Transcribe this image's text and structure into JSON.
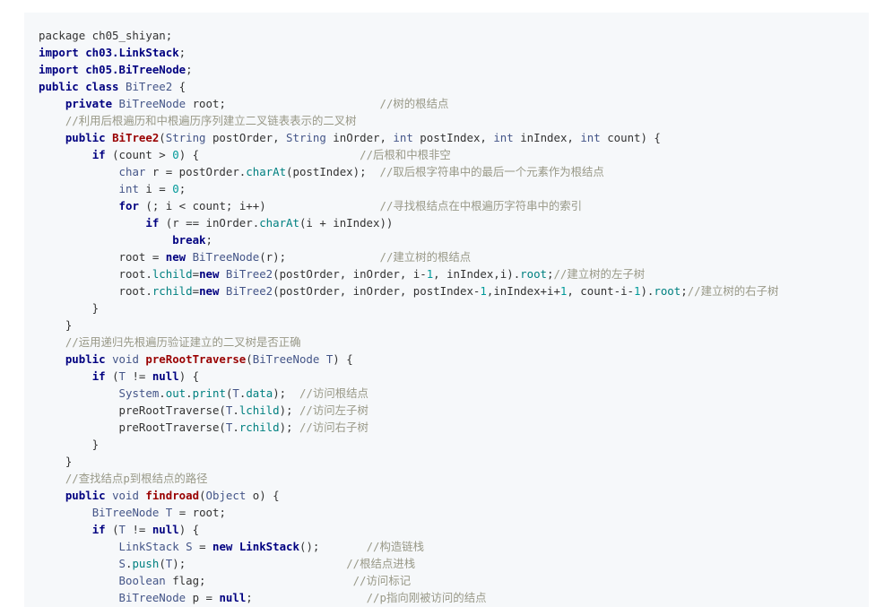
{
  "code_block": {
    "language": "java",
    "colors": {
      "background": "#f6f8fa",
      "text": "#333333",
      "keyword": "#000080",
      "type": "#445588",
      "method": "#990000",
      "comment": "#999988",
      "number": "#009999",
      "member": "#008080"
    },
    "lines": [
      [
        [
          "t",
          "package ch05_shiyan;"
        ]
      ],
      [
        [
          "k",
          "import "
        ],
        [
          "k",
          "ch03.LinkStack"
        ],
        [
          "t",
          ";"
        ]
      ],
      [
        [
          "k",
          "import "
        ],
        [
          "k",
          "ch05.BiTreeNode"
        ],
        [
          "t",
          ";"
        ]
      ],
      [
        [
          "k",
          "public class "
        ],
        [
          "y",
          "BiTree2"
        ],
        [
          "t",
          " {"
        ]
      ],
      [
        [
          "t",
          "    "
        ],
        [
          "k",
          "private "
        ],
        [
          "y",
          "BiTreeNode"
        ],
        [
          "t",
          " root;                       "
        ],
        [
          "c",
          "//树的根结点"
        ]
      ],
      [
        [
          "t",
          "    "
        ],
        [
          "c",
          "//利用后根遍历和中根遍历序列建立二叉链表表示的二叉树"
        ]
      ],
      [
        [
          "t",
          "    "
        ],
        [
          "k",
          "public "
        ],
        [
          "f",
          "BiTree2"
        ],
        [
          "t",
          "("
        ],
        [
          "y",
          "String"
        ],
        [
          "t",
          " postOrder, "
        ],
        [
          "y",
          "String"
        ],
        [
          "t",
          " inOrder, "
        ],
        [
          "y",
          "int"
        ],
        [
          "t",
          " postIndex, "
        ],
        [
          "y",
          "int"
        ],
        [
          "t",
          " inIndex, "
        ],
        [
          "y",
          "int"
        ],
        [
          "t",
          " count) {"
        ]
      ],
      [
        [
          "t",
          "        "
        ],
        [
          "k",
          "if"
        ],
        [
          "t",
          " (count > "
        ],
        [
          "n",
          "0"
        ],
        [
          "t",
          ") {                        "
        ],
        [
          "c",
          "//后根和中根非空"
        ]
      ],
      [
        [
          "t",
          "            "
        ],
        [
          "y",
          "char"
        ],
        [
          "t",
          " r = postOrder."
        ],
        [
          "m",
          "charAt"
        ],
        [
          "t",
          "(postIndex);  "
        ],
        [
          "c",
          "//取后根字符串中的最后一个元素作为根结点"
        ]
      ],
      [
        [
          "t",
          "            "
        ],
        [
          "y",
          "int"
        ],
        [
          "t",
          " i = "
        ],
        [
          "n",
          "0"
        ],
        [
          "t",
          ";"
        ]
      ],
      [
        [
          "t",
          "            "
        ],
        [
          "k",
          "for"
        ],
        [
          "t",
          " (; i < count; i++)                 "
        ],
        [
          "c",
          "//寻找根结点在中根遍历字符串中的索引"
        ]
      ],
      [
        [
          "t",
          "                "
        ],
        [
          "k",
          "if"
        ],
        [
          "t",
          " (r == inOrder."
        ],
        [
          "m",
          "charAt"
        ],
        [
          "t",
          "(i + inIndex))"
        ]
      ],
      [
        [
          "t",
          "                    "
        ],
        [
          "k",
          "break"
        ],
        [
          "t",
          ";"
        ]
      ],
      [
        [
          "t",
          "            root = "
        ],
        [
          "k",
          "new "
        ],
        [
          "y",
          "BiTreeNode"
        ],
        [
          "t",
          "(r);              "
        ],
        [
          "c",
          "//建立树的根结点"
        ]
      ],
      [
        [
          "t",
          "            root."
        ],
        [
          "m",
          "lchild"
        ],
        [
          "t",
          "="
        ],
        [
          "k",
          "new "
        ],
        [
          "y",
          "BiTree2"
        ],
        [
          "t",
          "(postOrder, inOrder, i-"
        ],
        [
          "n",
          "1"
        ],
        [
          "t",
          ", inIndex,i)."
        ],
        [
          "m",
          "root"
        ],
        [
          "t",
          ";"
        ],
        [
          "c",
          "//建立树的左子树"
        ]
      ],
      [
        [
          "t",
          "            root."
        ],
        [
          "m",
          "rchild"
        ],
        [
          "t",
          "="
        ],
        [
          "k",
          "new "
        ],
        [
          "y",
          "BiTree2"
        ],
        [
          "t",
          "(postOrder, inOrder, postIndex-"
        ],
        [
          "n",
          "1"
        ],
        [
          "t",
          ",inIndex+i+"
        ],
        [
          "n",
          "1"
        ],
        [
          "t",
          ", count-i-"
        ],
        [
          "n",
          "1"
        ],
        [
          "t",
          ")."
        ],
        [
          "m",
          "root"
        ],
        [
          "t",
          ";"
        ],
        [
          "c",
          "//建立树的右子树"
        ]
      ],
      [
        [
          "t",
          "        }"
        ]
      ],
      [
        [
          "t",
          "    }"
        ]
      ],
      [
        [
          "t",
          "    "
        ],
        [
          "c",
          "//运用递归先根遍历验证建立的二叉树是否正确"
        ]
      ],
      [
        [
          "t",
          "    "
        ],
        [
          "k",
          "public "
        ],
        [
          "y",
          "void"
        ],
        [
          "t",
          " "
        ],
        [
          "f",
          "preRootTraverse"
        ],
        [
          "t",
          "("
        ],
        [
          "y",
          "BiTreeNode"
        ],
        [
          "t",
          " "
        ],
        [
          "y",
          "T"
        ],
        [
          "t",
          ") {"
        ]
      ],
      [
        [
          "t",
          "        "
        ],
        [
          "k",
          "if"
        ],
        [
          "t",
          " ("
        ],
        [
          "y",
          "T"
        ],
        [
          "t",
          " != "
        ],
        [
          "k",
          "null"
        ],
        [
          "t",
          ") {"
        ]
      ],
      [
        [
          "t",
          "            "
        ],
        [
          "y",
          "System"
        ],
        [
          "t",
          "."
        ],
        [
          "m",
          "out"
        ],
        [
          "t",
          "."
        ],
        [
          "m",
          "print"
        ],
        [
          "t",
          "("
        ],
        [
          "y",
          "T"
        ],
        [
          "t",
          "."
        ],
        [
          "m",
          "data"
        ],
        [
          "t",
          ");  "
        ],
        [
          "c",
          "//访问根结点"
        ]
      ],
      [
        [
          "t",
          "            preRootTraverse("
        ],
        [
          "y",
          "T"
        ],
        [
          "t",
          "."
        ],
        [
          "m",
          "lchild"
        ],
        [
          "t",
          "); "
        ],
        [
          "c",
          "//访问左子树"
        ]
      ],
      [
        [
          "t",
          "            preRootTraverse("
        ],
        [
          "y",
          "T"
        ],
        [
          "t",
          "."
        ],
        [
          "m",
          "rchild"
        ],
        [
          "t",
          "); "
        ],
        [
          "c",
          "//访问右子树"
        ]
      ],
      [
        [
          "t",
          "        }"
        ]
      ],
      [
        [
          "t",
          "    }"
        ]
      ],
      [
        [
          "t",
          "    "
        ],
        [
          "c",
          "//查找结点p到根结点的路径"
        ]
      ],
      [
        [
          "t",
          "    "
        ],
        [
          "k",
          "public "
        ],
        [
          "y",
          "void"
        ],
        [
          "t",
          " "
        ],
        [
          "f",
          "findroad"
        ],
        [
          "t",
          "("
        ],
        [
          "y",
          "Object"
        ],
        [
          "t",
          " o) {"
        ]
      ],
      [
        [
          "t",
          "        "
        ],
        [
          "y",
          "BiTreeNode"
        ],
        [
          "t",
          " "
        ],
        [
          "y",
          "T"
        ],
        [
          "t",
          " = root;"
        ]
      ],
      [
        [
          "t",
          "        "
        ],
        [
          "k",
          "if"
        ],
        [
          "t",
          " ("
        ],
        [
          "y",
          "T"
        ],
        [
          "t",
          " != "
        ],
        [
          "k",
          "null"
        ],
        [
          "t",
          ") {"
        ]
      ],
      [
        [
          "t",
          "            "
        ],
        [
          "y",
          "LinkStack"
        ],
        [
          "t",
          " "
        ],
        [
          "y",
          "S"
        ],
        [
          "t",
          " = "
        ],
        [
          "k",
          "new "
        ],
        [
          "k",
          "LinkStack"
        ],
        [
          "t",
          "();       "
        ],
        [
          "c",
          "//构造链栈"
        ]
      ],
      [
        [
          "t",
          "            "
        ],
        [
          "y",
          "S"
        ],
        [
          "t",
          "."
        ],
        [
          "m",
          "push"
        ],
        [
          "t",
          "("
        ],
        [
          "y",
          "T"
        ],
        [
          "t",
          ");                        "
        ],
        [
          "c",
          "//根结点进栈"
        ]
      ],
      [
        [
          "t",
          "            "
        ],
        [
          "y",
          "Boolean"
        ],
        [
          "t",
          " flag;                      "
        ],
        [
          "c",
          "//访问标记"
        ]
      ],
      [
        [
          "t",
          "            "
        ],
        [
          "y",
          "BiTreeNode"
        ],
        [
          "t",
          " p = "
        ],
        [
          "k",
          "null"
        ],
        [
          "t",
          ";                 "
        ],
        [
          "c",
          "//p指向刚被访问的结点"
        ]
      ]
    ]
  }
}
